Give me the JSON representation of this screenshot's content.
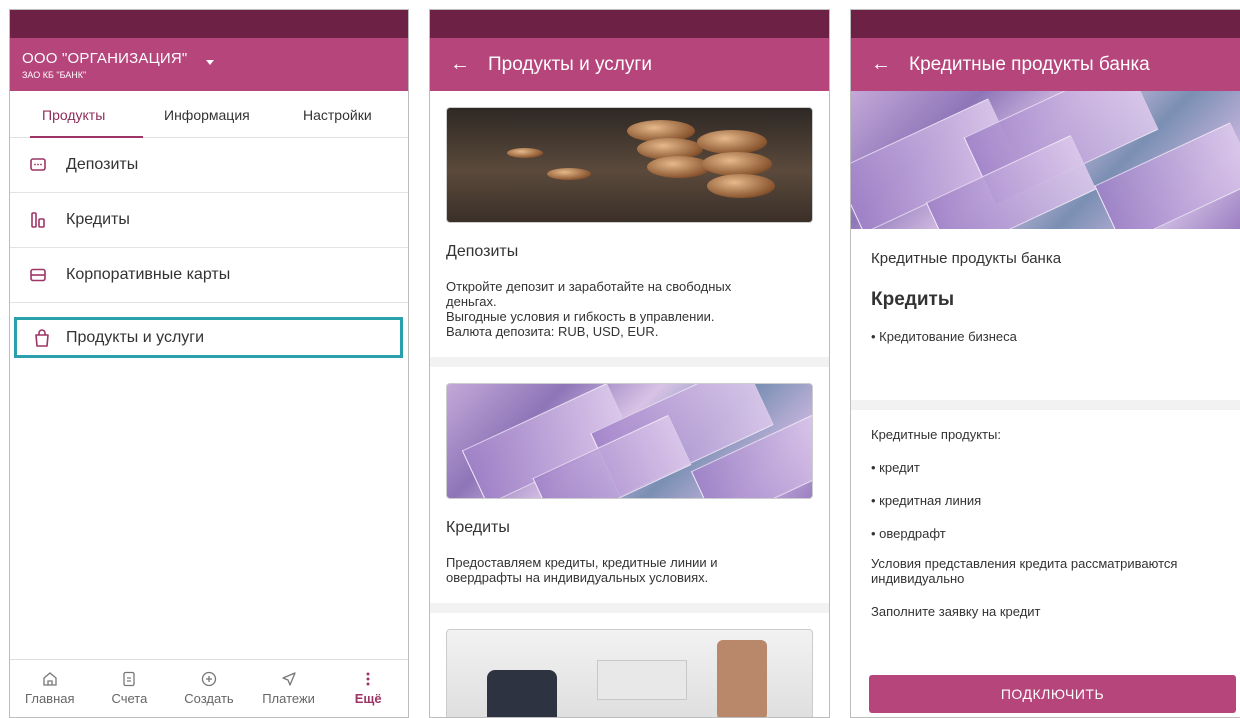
{
  "screen1": {
    "org_name": "ООО \"ОРГАНИЗАЦИЯ\"",
    "bank_name": "ЗАО КБ \"БАНК\"",
    "tabs": [
      {
        "label": "Продукты",
        "active": true
      },
      {
        "label": "Информация",
        "active": false
      },
      {
        "label": "Настройки",
        "active": false
      }
    ],
    "menu": [
      {
        "label": "Депозиты",
        "icon": "deposit-icon"
      },
      {
        "label": "Кредиты",
        "icon": "credit-icon"
      },
      {
        "label": "Корпоративные карты",
        "icon": "card-icon"
      },
      {
        "label": "Продукты и услуги",
        "icon": "bag-icon",
        "selected": true
      }
    ],
    "bottom_nav": [
      {
        "label": "Главная",
        "icon": "home-icon"
      },
      {
        "label": "Счета",
        "icon": "document-icon"
      },
      {
        "label": "Создать",
        "icon": "plus-circle-icon"
      },
      {
        "label": "Платежи",
        "icon": "send-icon"
      },
      {
        "label": "Ещё",
        "icon": "more-icon",
        "active": true
      }
    ]
  },
  "screen2": {
    "title": "Продукты и услуги",
    "cards": [
      {
        "title": "Депозиты",
        "description_lines": [
          "Откройте депозит и заработайте на свободных",
          "деньгах.",
          "Выгодные условия и гибкость в управлении.",
          "Валюта депозита: RUB, USD, EUR."
        ]
      },
      {
        "title": "Кредиты",
        "description_lines": [
          "Предоставляем кредиты, кредитные линии и",
          "овердрафты на индивидуальных условиях."
        ]
      }
    ]
  },
  "screen3": {
    "title": "Кредитные продукты банка",
    "subtitle": "Кредитные продукты банка",
    "heading": "Кредиты",
    "bullet1": "• Кредитование бизнеса",
    "products_label": "Кредитные продукты:",
    "products": [
      "• кредит",
      "• кредитная линия",
      "• овердрафт"
    ],
    "conditions_lines": [
      "Условия представления кредита рассматриваются",
      "индивидуально"
    ],
    "apply_text": "Заполните заявку на кредит",
    "connect_button": "ПОДКЛЮЧИТЬ"
  },
  "colors": {
    "status_bar": "#6d2145",
    "app_bar": "#b5457a",
    "accent": "#9e3566",
    "selection_outline": "#2aa0ad"
  }
}
